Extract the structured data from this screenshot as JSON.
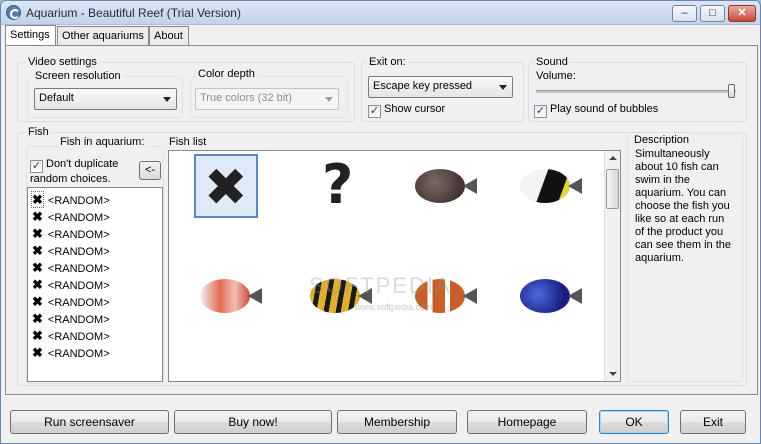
{
  "window": {
    "title": "Aquarium - Beautiful Reef (Trial Version)",
    "controls": {
      "minimize": "–",
      "maximize": "□",
      "close": "✕"
    }
  },
  "tabs": [
    {
      "label": "Settings",
      "active": true
    },
    {
      "label": "Other aquariums",
      "active": false
    },
    {
      "label": "About",
      "active": false
    }
  ],
  "video_settings": {
    "group_label": "Video settings",
    "screen_resolution_label": "Screen resolution",
    "screen_resolution_value": "Default",
    "color_depth_label": "Color depth",
    "color_depth_value": "True colors (32 bit)"
  },
  "exit_on": {
    "group_label": "Exit on:",
    "value": "Escape key pressed",
    "show_cursor_label": "Show cursor",
    "show_cursor_checked": true
  },
  "sound": {
    "group_label": "Sound",
    "volume_label": "Volume:",
    "volume_level": 1.0,
    "bubbles_label": "Play sound of bubbles",
    "bubbles_checked": true
  },
  "fish": {
    "group_label": "Fish",
    "in_aquarium_label": "Fish in aquarium:",
    "dont_duplicate_label": "Don't duplicate random choices.",
    "dont_duplicate_checked": true,
    "move_button_label": "<-",
    "items": [
      "<RANDOM>",
      "<RANDOM>",
      "<RANDOM>",
      "<RANDOM>",
      "<RANDOM>",
      "<RANDOM>",
      "<RANDOM>",
      "<RANDOM>",
      "<RANDOM>",
      "<RANDOM>"
    ],
    "list_label": "Fish list",
    "grid_icons": [
      "remove-x-icon",
      "random-question-icon",
      "dark-fish-icon",
      "black-white-fish-icon",
      "red-white-fish-icon",
      "striped-yellow-fish-icon",
      "clown-fish-icon",
      "blue-fish-icon"
    ],
    "colors": {
      "dark": "#4a3c38",
      "bw": "#e8e8e8",
      "red": "#d8604a",
      "yellow": "#d8a830",
      "orange": "#c96a30",
      "blue": "#2a3aa8"
    }
  },
  "description": {
    "label": "Description",
    "text": "Simultaneously\nabout 10 fish can\nswim in the\naquarium. You can\nchoose the fish you\nlike so at each run\nof the product you\ncan see them in the\naquarium."
  },
  "watermark": {
    "text": "SOFTPEDIA",
    "sub": "www.softpedia.com"
  },
  "buttons": {
    "run_screensaver": "Run screensaver",
    "buy_now": "Buy now!",
    "membership": "Membership",
    "homepage": "Homepage",
    "ok": "OK",
    "exit": "Exit"
  }
}
